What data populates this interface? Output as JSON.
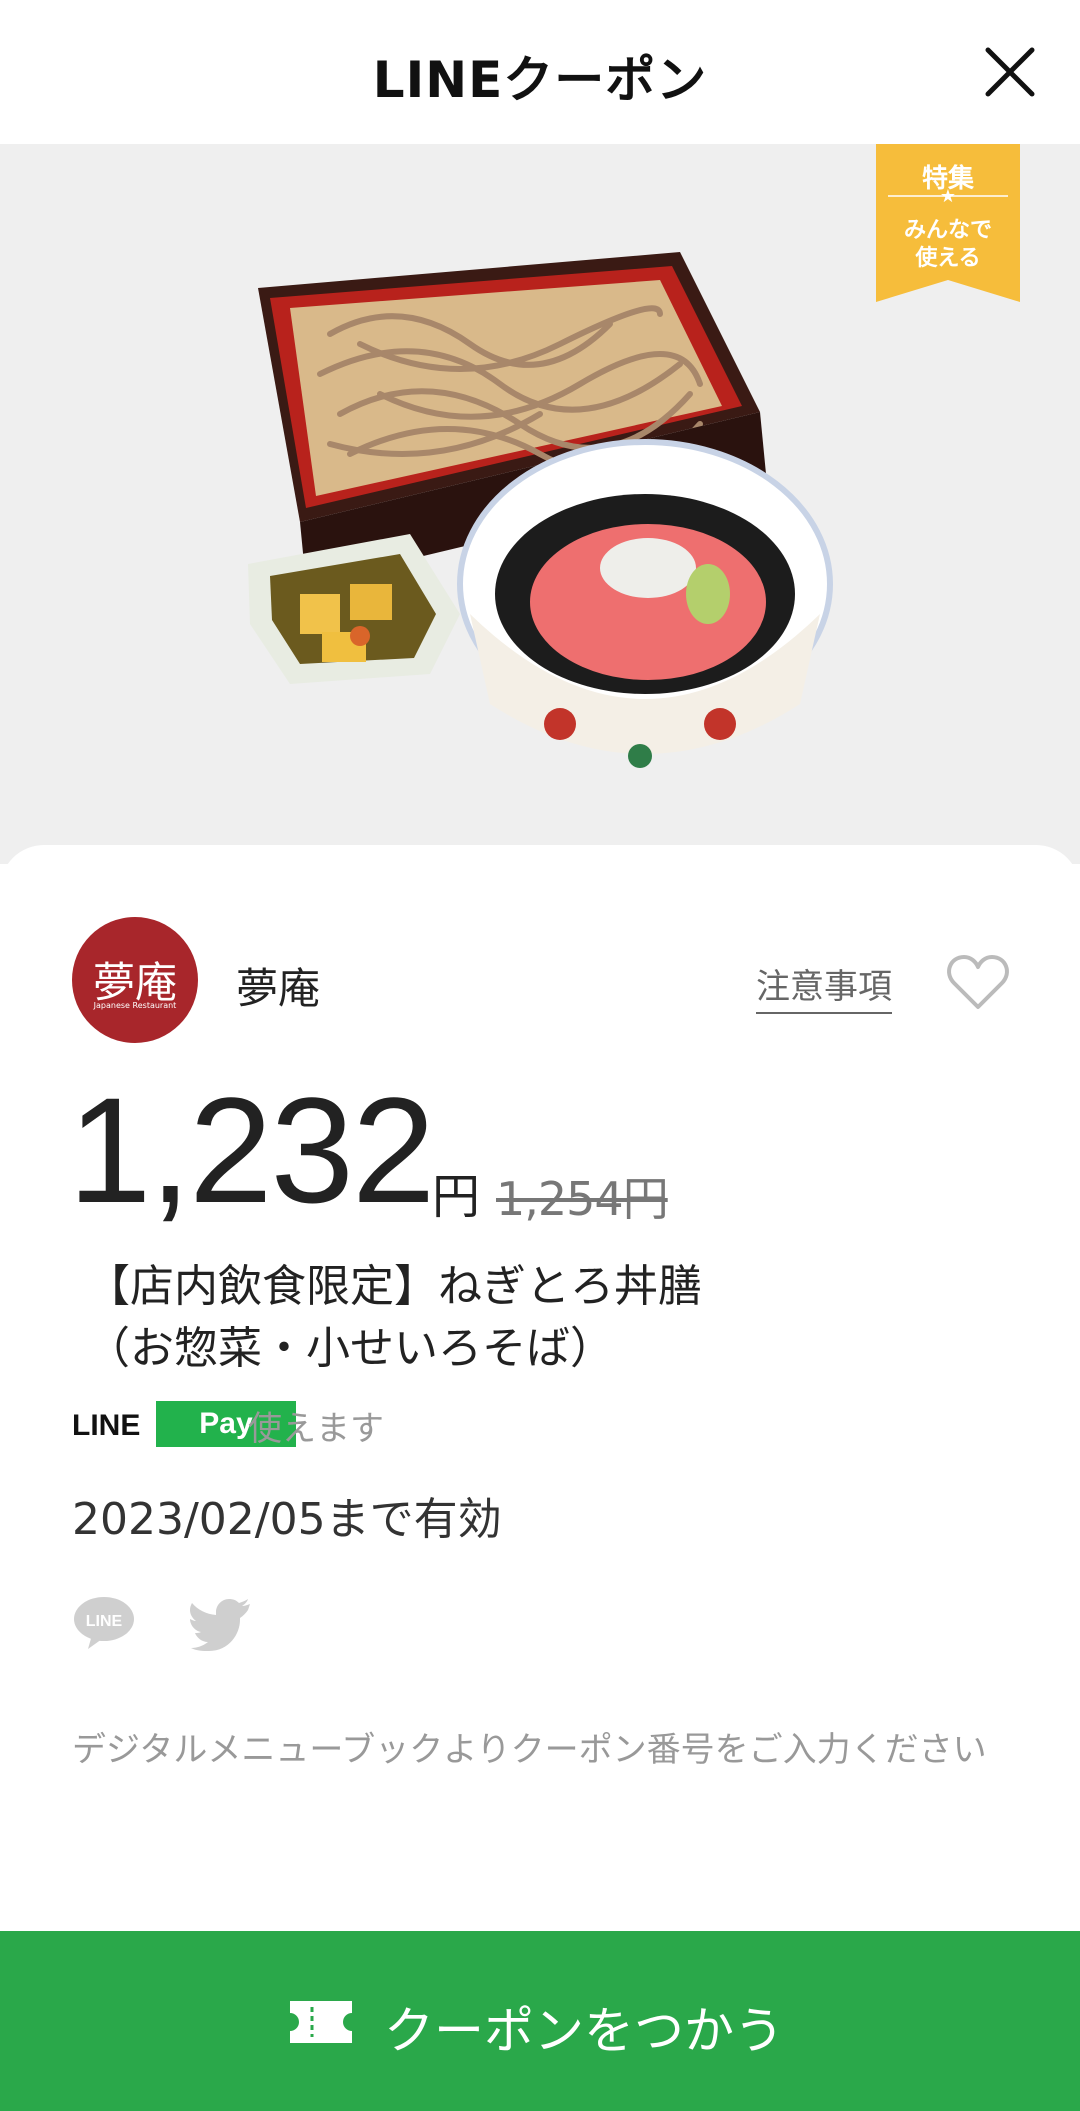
{
  "header": {
    "title": "LINEクーポン"
  },
  "hero": {
    "ribbon": {
      "line1": "特集",
      "star": "★",
      "line2": "みんなで",
      "line3": "使える"
    }
  },
  "shop": {
    "logo_text": "夢庵",
    "logo_sub": "Japanese Restaurant",
    "name": "夢庵"
  },
  "links": {
    "notes": "注意事項"
  },
  "price": {
    "value": "1,232",
    "unit": "円",
    "original": "1,254円"
  },
  "coupon": {
    "title_line1": "【店内飲食限定】ねぎとろ丼膳",
    "title_line2": "（お惣菜・小せいろそば）"
  },
  "payment": {
    "line_text": "LINE",
    "pay_text": "Pay",
    "note": "使えます"
  },
  "validity": "2023/02/05まで有効",
  "note": "デジタルメニューブックよりクーポン番号をご入力ください",
  "cta": {
    "label": "クーポンをつかう"
  },
  "icons": {
    "close": "close-icon",
    "favorite": "heart-outline-icon",
    "share_line": "line-speech-bubble-icon",
    "share_twitter": "twitter-bird-icon",
    "ticket": "ticket-icon"
  },
  "colors": {
    "brand_green": "#2aa84a",
    "line_pay_green": "#22b24c",
    "ribbon": "#f6bd3b",
    "logo_red": "#a8262b"
  }
}
